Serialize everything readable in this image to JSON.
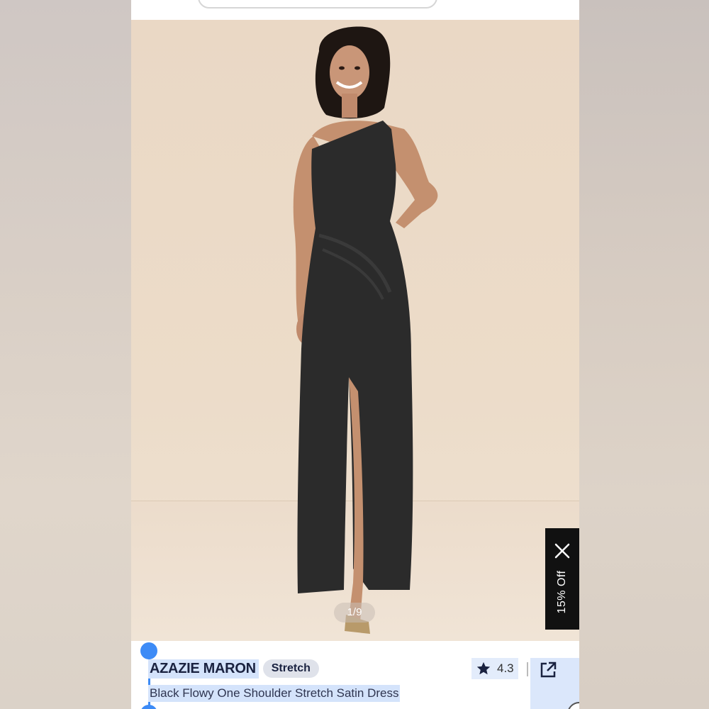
{
  "product": {
    "brand": "AZAZIE MARON",
    "badge": "Stretch",
    "title": "Black Flowy One Shoulder Stretch Satin Dress",
    "rating": "4.3"
  },
  "gallery": {
    "counter": "1/9"
  },
  "promo": {
    "label": "15% Off"
  },
  "icons": {
    "close": "close-icon",
    "star": "star-icon",
    "share": "share-icon",
    "more": "more-icon"
  },
  "colors": {
    "selection": "#3d8bf6",
    "selection_highlight": "#d4e3fb",
    "brand_text": "#1a2240",
    "promo_bg": "#111111",
    "dress": "#2b2b2b",
    "backdrop": "#ead8c5"
  }
}
